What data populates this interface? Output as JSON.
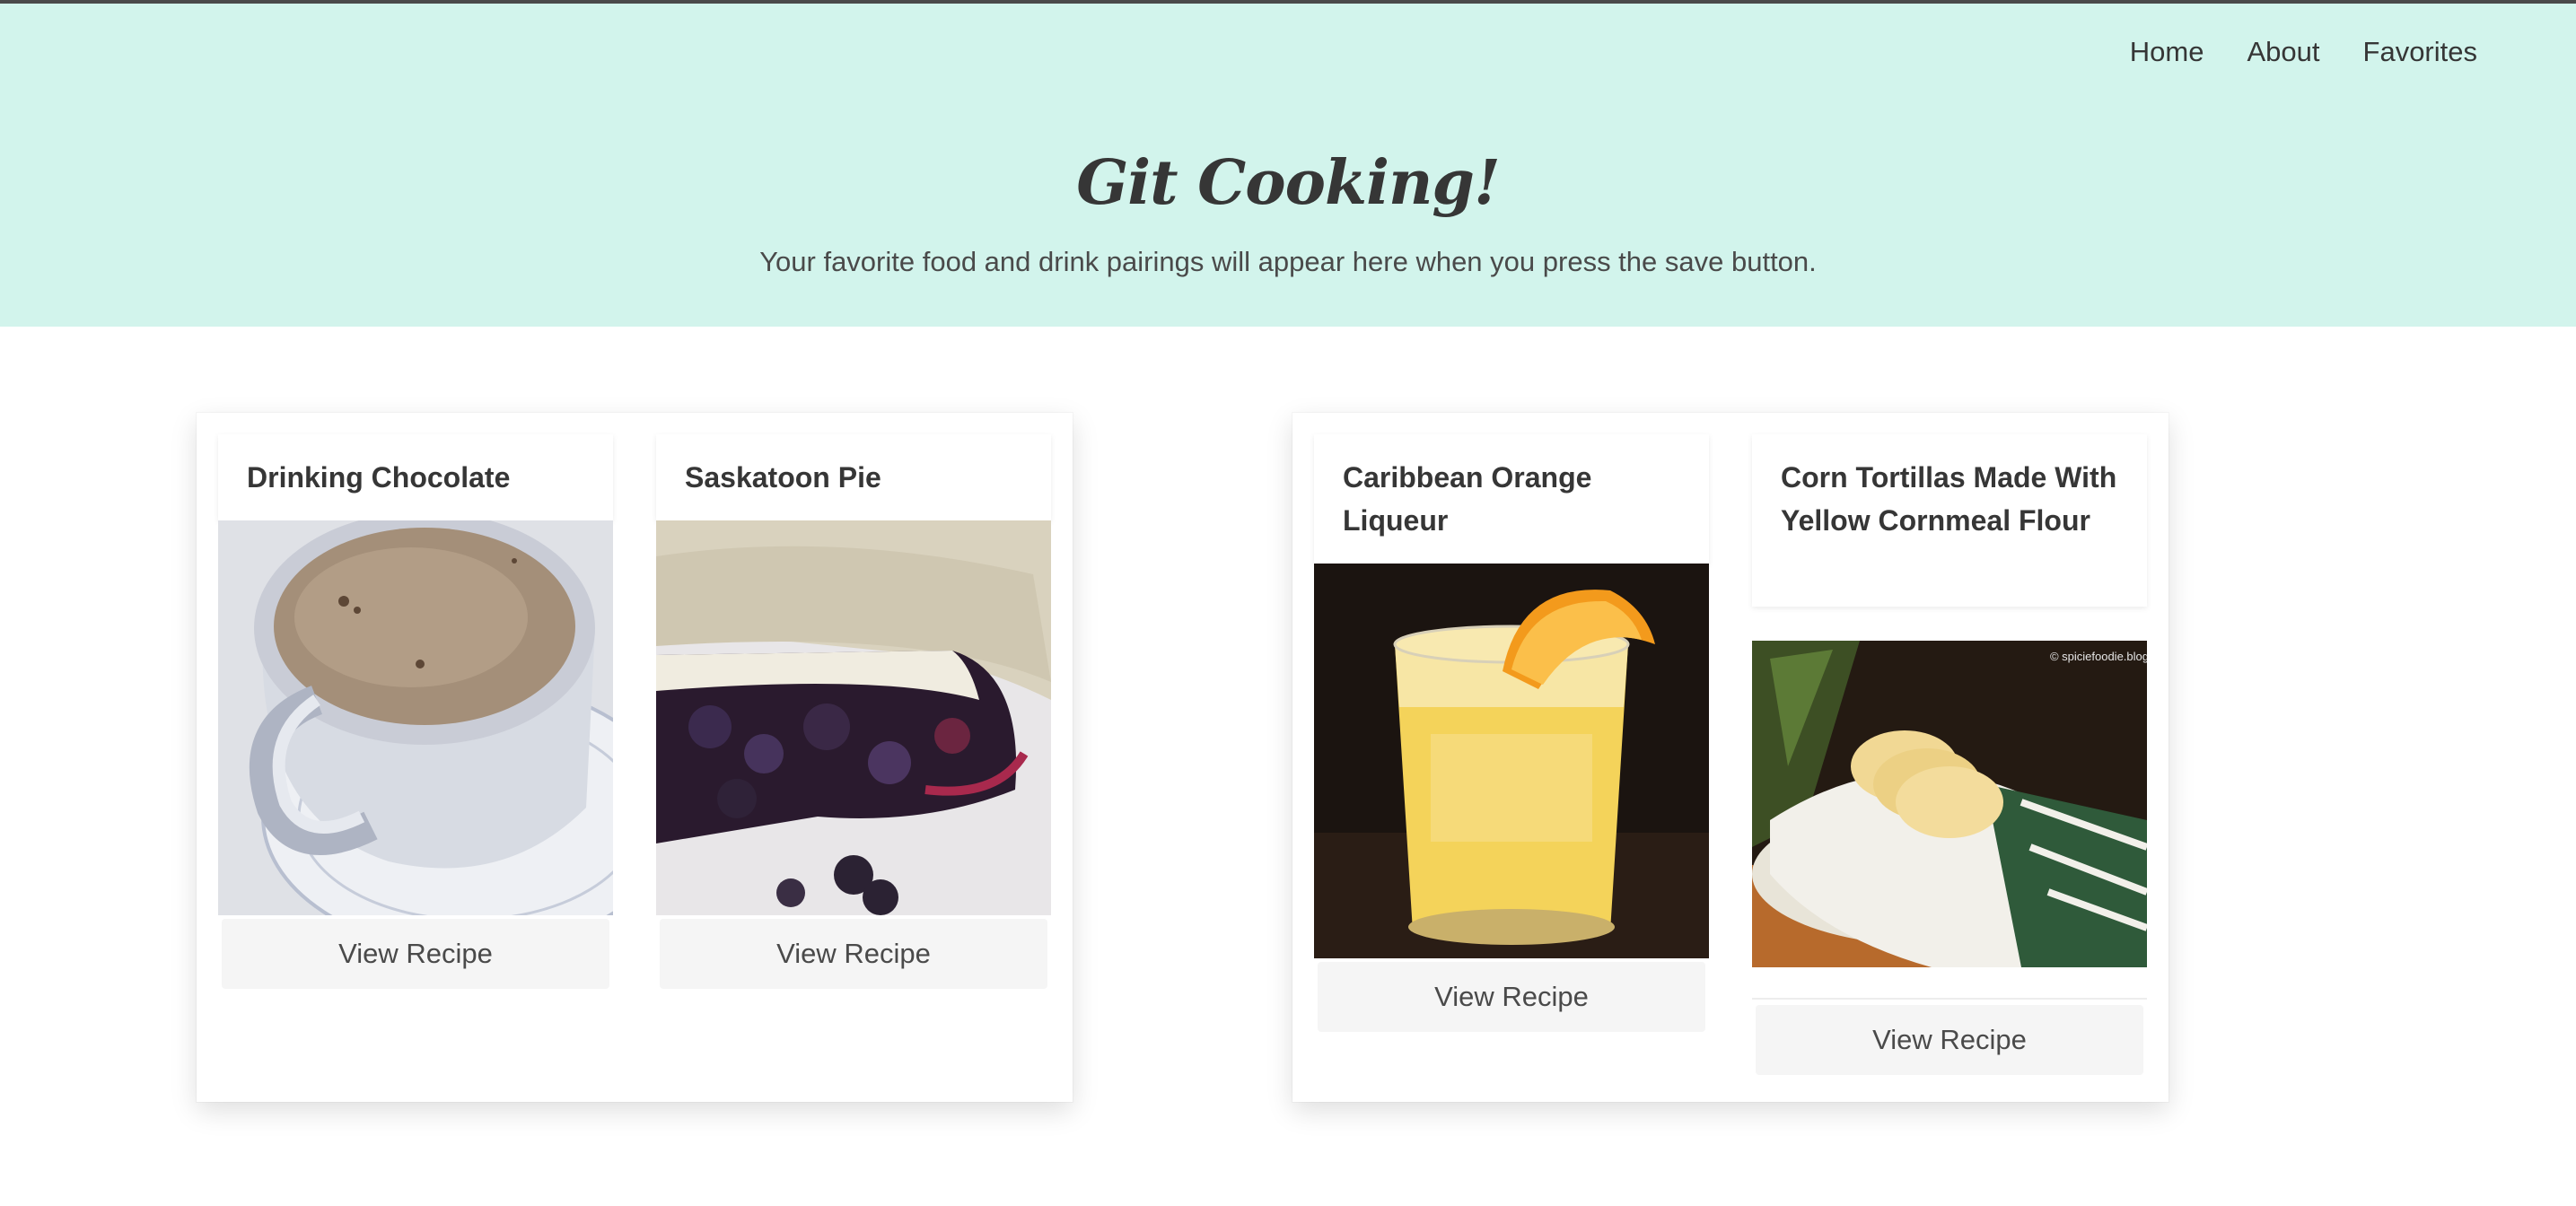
{
  "nav": {
    "home": "Home",
    "about": "About",
    "favorites": "Favorites"
  },
  "hero": {
    "title": "Git Cooking!",
    "subtitle": "Your favorite food and drink pairings will appear here when you press the save button."
  },
  "pairings": [
    {
      "food": {
        "title": "Drinking Chocolate",
        "button": "View Recipe",
        "image": "cup-of-hot-chocolate"
      },
      "drink": {
        "title": "Saskatoon Pie",
        "button": "View Recipe",
        "image": "slice-of-berry-pie"
      }
    },
    {
      "food": {
        "title": "Caribbean Orange Liqueur",
        "button": "View Recipe",
        "image": "glass-of-orange-drink"
      },
      "drink": {
        "title": "Corn Tortillas Made With Yellow Cornmeal Flour",
        "button": "View Recipe",
        "image": "basket-of-tortillas",
        "watermark": "© spiciefoodie.blog"
      }
    }
  ],
  "colors": {
    "hero_bg": "#d2f4ec",
    "button_bg": "#f5f5f5",
    "text": "#363636"
  }
}
